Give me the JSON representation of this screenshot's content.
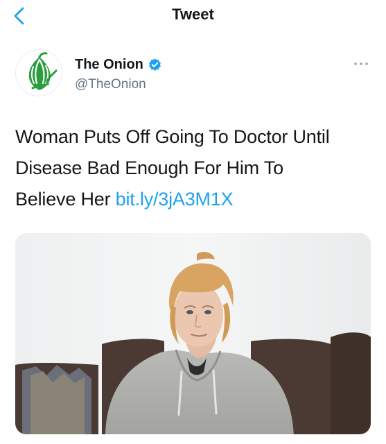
{
  "nav": {
    "title": "Tweet"
  },
  "author": {
    "display_name": "The Onion",
    "handle": "@TheOnion"
  },
  "tweet": {
    "text_line1": "Woman Puts Off Going To Doctor Until",
    "text_line2": "Disease Bad Enough For Him To",
    "text_line3": "Believe Her ",
    "link": "bit.ly/3jA3M1X"
  },
  "icons": {
    "back": "chevron-left-icon",
    "verified": "verified-badge-icon",
    "more": "more-horizontal-icon",
    "avatar": "onion-logo"
  },
  "colors": {
    "link": "#1da1f2",
    "brand_green": "#2a9d3f",
    "secondary_text": "#657786"
  }
}
